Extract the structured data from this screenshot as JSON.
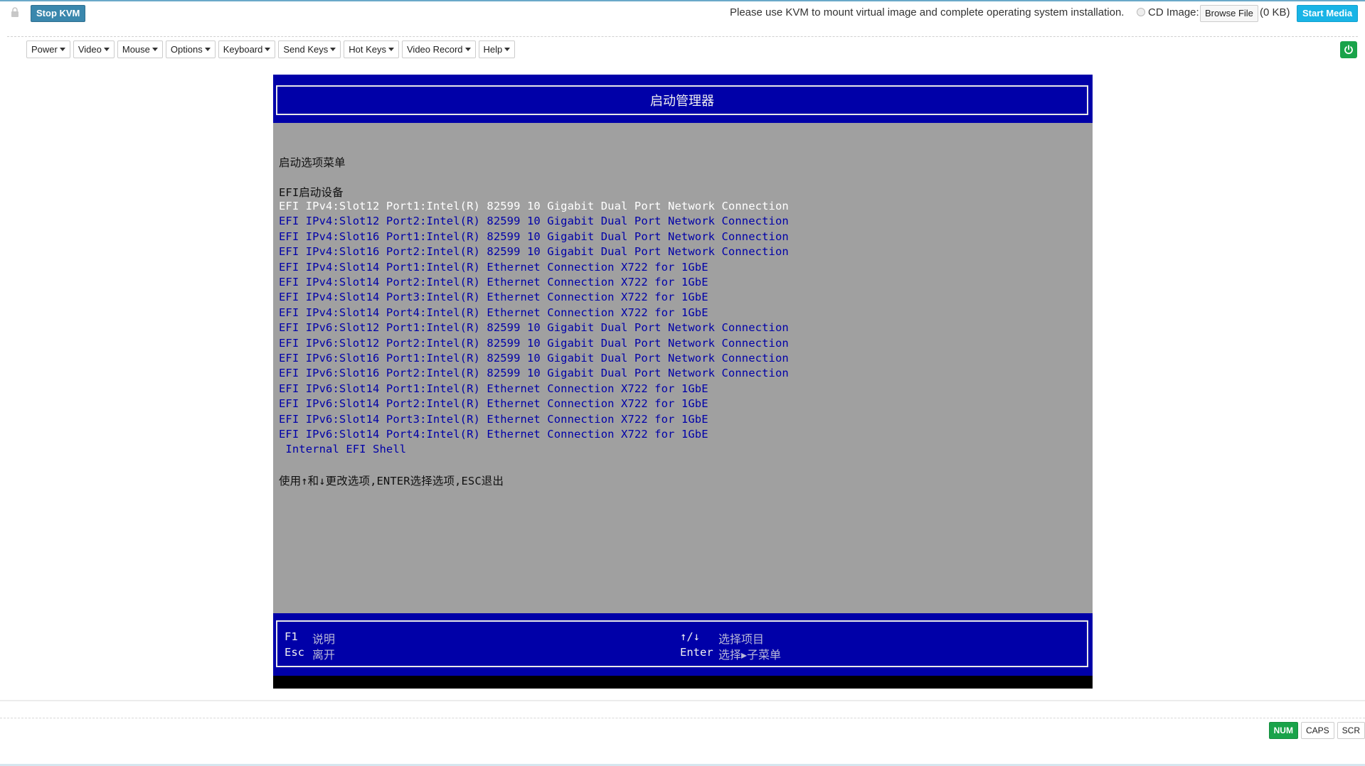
{
  "toolbar": {
    "stop_kvm": "Stop KVM",
    "message": "Please use KVM to mount virtual image and complete operating system installation.",
    "cd_image_label": "CD Image:",
    "browse_file": "Browse File",
    "file_size": "(0 KB)",
    "start_media": "Start Media"
  },
  "menu": [
    {
      "label": "Power"
    },
    {
      "label": "Video"
    },
    {
      "label": "Mouse"
    },
    {
      "label": "Options"
    },
    {
      "label": "Keyboard"
    },
    {
      "label": "Send Keys"
    },
    {
      "label": "Hot Keys"
    },
    {
      "label": "Video Record"
    },
    {
      "label": "Help"
    }
  ],
  "screen": {
    "header_title": "启动管理器",
    "menu_title": "启动选项菜单",
    "section_title": "EFI启动设备",
    "selected_index": 0,
    "boot_items": [
      "EFI IPv4:Slot12 Port1:Intel(R) 82599 10 Gigabit Dual Port Network Connection",
      "EFI IPv4:Slot12 Port2:Intel(R) 82599 10 Gigabit Dual Port Network Connection",
      "EFI IPv4:Slot16 Port1:Intel(R) 82599 10 Gigabit Dual Port Network Connection",
      "EFI IPv4:Slot16 Port2:Intel(R) 82599 10 Gigabit Dual Port Network Connection",
      "EFI IPv4:Slot14 Port1:Intel(R) Ethernet Connection X722 for 1GbE",
      "EFI IPv4:Slot14 Port2:Intel(R) Ethernet Connection X722 for 1GbE",
      "EFI IPv4:Slot14 Port3:Intel(R) Ethernet Connection X722 for 1GbE",
      "EFI IPv4:Slot14 Port4:Intel(R) Ethernet Connection X722 for 1GbE",
      "EFI IPv6:Slot12 Port1:Intel(R) 82599 10 Gigabit Dual Port Network Connection",
      "EFI IPv6:Slot12 Port2:Intel(R) 82599 10 Gigabit Dual Port Network Connection",
      "EFI IPv6:Slot16 Port1:Intel(R) 82599 10 Gigabit Dual Port Network Connection",
      "EFI IPv6:Slot16 Port2:Intel(R) 82599 10 Gigabit Dual Port Network Connection",
      "EFI IPv6:Slot14 Port1:Intel(R) Ethernet Connection X722 for 1GbE",
      "EFI IPv6:Slot14 Port2:Intel(R) Ethernet Connection X722 for 1GbE",
      "EFI IPv6:Slot14 Port3:Intel(R) Ethernet Connection X722 for 1GbE",
      "EFI IPv6:Slot14 Port4:Intel(R) Ethernet Connection X722 for 1GbE",
      " Internal EFI Shell"
    ],
    "hint": "使用↑和↓更改选项,ENTER选择选项,ESC退出",
    "footer": {
      "f1_key": "F1",
      "f1_desc": "说明",
      "esc_key": "Esc",
      "esc_desc": "离开",
      "arrows_key": "↑/↓",
      "arrows_desc": "选择项目",
      "enter_key": "Enter",
      "enter_desc": "选择▸子菜单"
    }
  },
  "status": {
    "num": "NUM",
    "caps": "CAPS",
    "scr": "SCR",
    "num_on": true,
    "caps_on": false,
    "scr_on": false
  },
  "colors": {
    "bios_blue": "#0000a8",
    "bios_gray": "#a0a0a0",
    "stop_kvm": "#3a87ad",
    "start_media": "#19b4e6",
    "indicator_on": "#1aa34a"
  }
}
